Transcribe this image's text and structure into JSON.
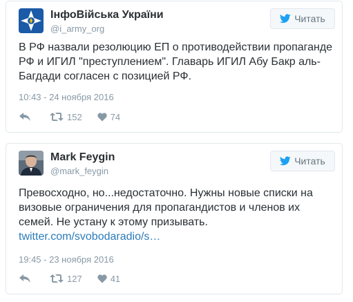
{
  "colors": {
    "name": "#292f33",
    "handle": "#8899a6",
    "link": "#2b7bb9",
    "twitter_blue": "#1da1f2",
    "border": "#e1e8ed"
  },
  "tweets": [
    {
      "author_name": "ІнфоВійська України",
      "author_handle": "@i_army_org",
      "avatar_icon": "ukraine-army-emblem",
      "follow_icon": "twitter-bird-icon",
      "follow_label": "Читать",
      "text": "В РФ назвали резолюцию ЕП о противодействии пропаганде РФ и ИГИЛ \"преступлением\". Главарь ИГИЛ Абу Бакр аль-Багдади согласен с позицией РФ.",
      "link": "",
      "date": "10:43 - 24 ноября 2016",
      "retweets": "152",
      "likes": "74"
    },
    {
      "author_name": "Mark Feygin",
      "author_handle": "@mark_feygin",
      "avatar_icon": "profile-photo",
      "follow_icon": "twitter-bird-icon",
      "follow_label": "Читать",
      "text": "Превосходно, но...недостаточно. Нужны новые списки на визовые ограничения для пропагандистов и членов их семей. Не устану к этому призывать.",
      "link": "twitter.com/svobodaradio/s…",
      "date": "19:45 - 23 ноября 2016",
      "retweets": "127",
      "likes": "41"
    }
  ]
}
